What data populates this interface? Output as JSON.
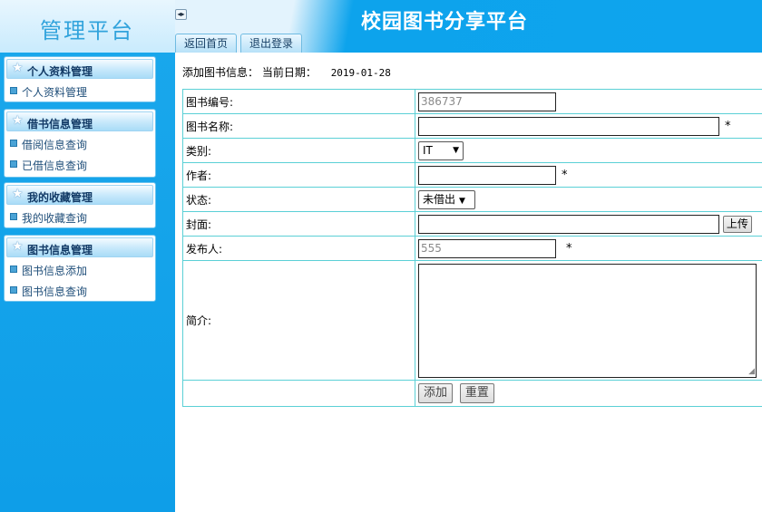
{
  "sidebar": {
    "brand_title": "管理平台",
    "groups": [
      {
        "title": "个人资料管理",
        "items": [
          "个人资料管理"
        ]
      },
      {
        "title": "借书信息管理",
        "items": [
          "借阅信息查询",
          "已借信息查询"
        ]
      },
      {
        "title": "我的收藏管理",
        "items": [
          "我的收藏查询"
        ]
      },
      {
        "title": "图书信息管理",
        "items": [
          "图书信息添加",
          "图书信息查询"
        ]
      }
    ]
  },
  "header": {
    "site_title": "校园图书分享平台",
    "tabs": [
      "返回首页",
      "退出登录"
    ],
    "toggle_glyph": "◂▸"
  },
  "main": {
    "info_label": "添加图书信息：",
    "date_label": "当前日期：",
    "date_value": "2019-01-28",
    "form": {
      "book_id_label": "图书编号:",
      "book_id_value": "386737",
      "book_name_label": "图书名称:",
      "book_name_value": "",
      "category_label": "类别:",
      "category_value": "IT",
      "author_label": "作者:",
      "author_value": "",
      "status_label": "状态:",
      "status_value": "未借出",
      "cover_label": "封面:",
      "cover_value": "",
      "upload_label": "上传",
      "publisher_label": "发布人:",
      "publisher_value": "555",
      "intro_label": "简介:",
      "intro_value": "",
      "required_mark": "*",
      "add_button": "添加",
      "reset_button": "重置"
    }
  },
  "colors": {
    "sidebar_bg": "#1aa8ec",
    "header_bg": "#0ea4ee",
    "table_border": "#5bd0d6"
  }
}
